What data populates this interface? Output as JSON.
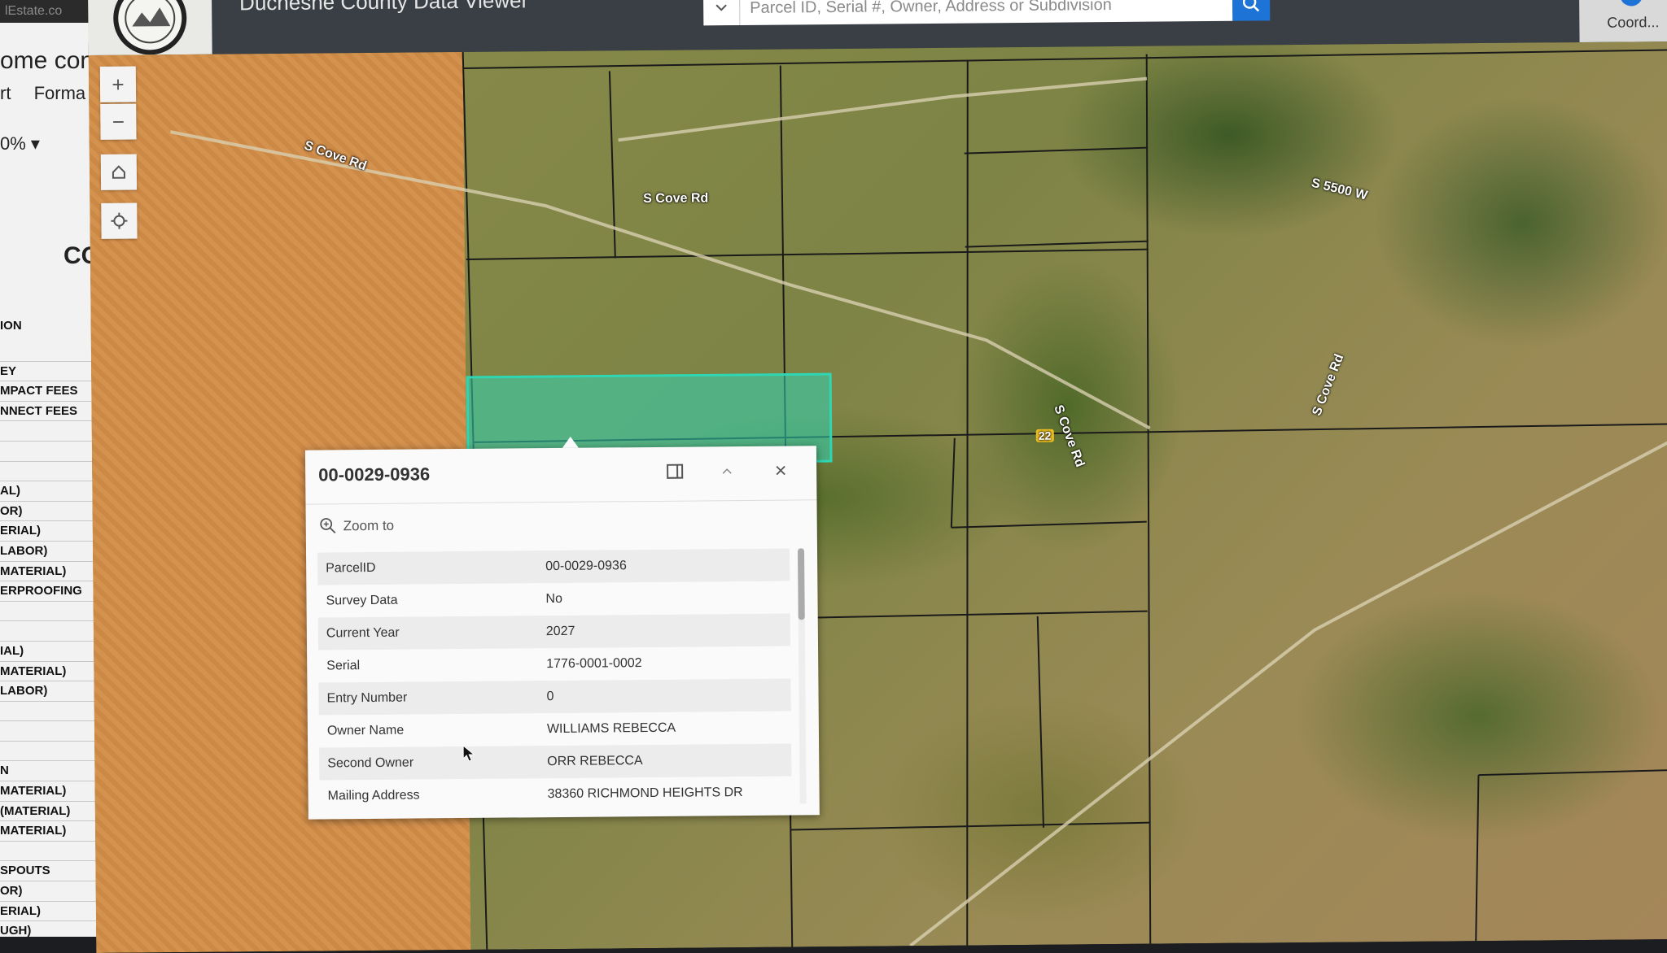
{
  "sheet": {
    "url_fragment": "lEstate.co",
    "title_fragment": "ome con",
    "menu_fragments": [
      "rt",
      "Forma"
    ],
    "zoom_fragment": "0%",
    "big_fragment": "CO",
    "header_fragment": "ION",
    "rows": [
      "",
      "EY",
      "MPACT FEES",
      "NNECT FEES",
      "",
      "",
      "",
      "AL)",
      "OR)",
      "ERIAL)",
      "LABOR)",
      "MATERIAL)",
      "ERPROOFING",
      "",
      "",
      "IAL)",
      "MATERIAL)",
      "LABOR)",
      "",
      "",
      "",
      "N",
      "MATERIAL)",
      "(MATERIAL)",
      "MATERIAL)",
      "",
      "SPOUTS",
      "OR)",
      "ERIAL)",
      "UGH)"
    ]
  },
  "header": {
    "title": "Duchesne County Data Viewer",
    "search_placeholder": "Parcel ID, Serial #, Owner, Address or Subdivision",
    "coord_label": "Coord..."
  },
  "map": {
    "roads": [
      "S Cove Rd",
      "S Cove Rd",
      "S 5500 W",
      "S Cove Rd",
      "S Cove Rd"
    ],
    "route_shield": "22"
  },
  "popup": {
    "title": "00-0029-0936",
    "zoom_to": "Zoom to",
    "attributes": [
      {
        "key": "ParcelID",
        "value": "00-0029-0936"
      },
      {
        "key": "Survey Data",
        "value": "No"
      },
      {
        "key": "Current Year",
        "value": "2027"
      },
      {
        "key": "Serial",
        "value": "1776-0001-0002"
      },
      {
        "key": "Entry Number",
        "value": "0"
      },
      {
        "key": "Owner Name",
        "value": "WILLIAMS REBECCA"
      },
      {
        "key": "Second Owner",
        "value": "ORR REBECCA"
      },
      {
        "key": "Mailing Address",
        "value": "38360 RICHMOND HEIGHTS DR"
      }
    ]
  },
  "colors": {
    "accent": "#1e74d6",
    "header_bg": "#3a3f45",
    "selected_parcel": "#2fd6b4"
  },
  "icons": [
    "search-icon",
    "chevron-down-icon",
    "zoom-in-icon",
    "zoom-out-icon",
    "home-icon",
    "locate-icon",
    "dock-icon",
    "collapse-icon",
    "close-icon",
    "zoom-to-icon",
    "coordinate-icon",
    "county-seal-icon"
  ]
}
